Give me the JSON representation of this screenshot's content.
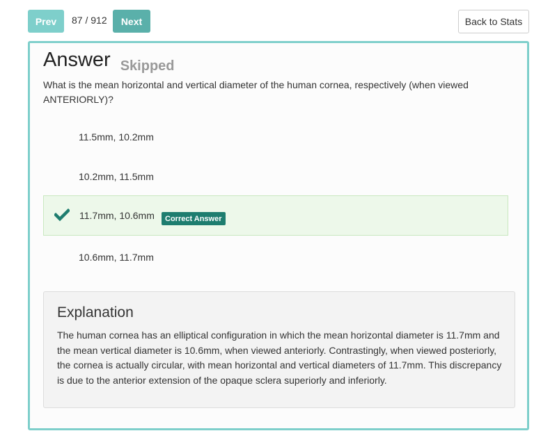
{
  "nav": {
    "prev_label": "Prev",
    "counter": "87 / 912",
    "next_label": "Next",
    "back_label": "Back to Stats"
  },
  "answer": {
    "title": "Answer",
    "status": "Skipped",
    "question": "What is the mean horizontal and vertical diameter of the human cornea, respectively (when viewed ANTERIORLY)?"
  },
  "options": [
    {
      "text": "11.5mm, 10.2mm",
      "correct": false
    },
    {
      "text": "10.2mm, 11.5mm",
      "correct": false
    },
    {
      "text": "11.7mm, 10.6mm",
      "correct": true,
      "badge": "Correct Answer"
    },
    {
      "text": "10.6mm, 11.7mm",
      "correct": false
    }
  ],
  "explanation": {
    "title": "Explanation",
    "body": "The human cornea has an elliptical configuration in which the mean horizontal diameter is 11.7mm and the mean vertical diameter is 10.6mm, when viewed anteriorly. Contrastingly, when viewed posteriorly, the cornea is actually circular, with mean horizontal and vertical diameters of 11.7mm. This discrepancy is due to the anterior extension of the opaque sclera superiorly and inferiorly."
  },
  "colors": {
    "accent": "#7ecfcb",
    "next_button": "#5ab0aa",
    "correct_badge": "#1e7d6f",
    "correct_row_bg": "#edf8ea",
    "check_icon": "#1e7d6f"
  },
  "icons": {
    "correct_marker": "checkmark-icon"
  }
}
